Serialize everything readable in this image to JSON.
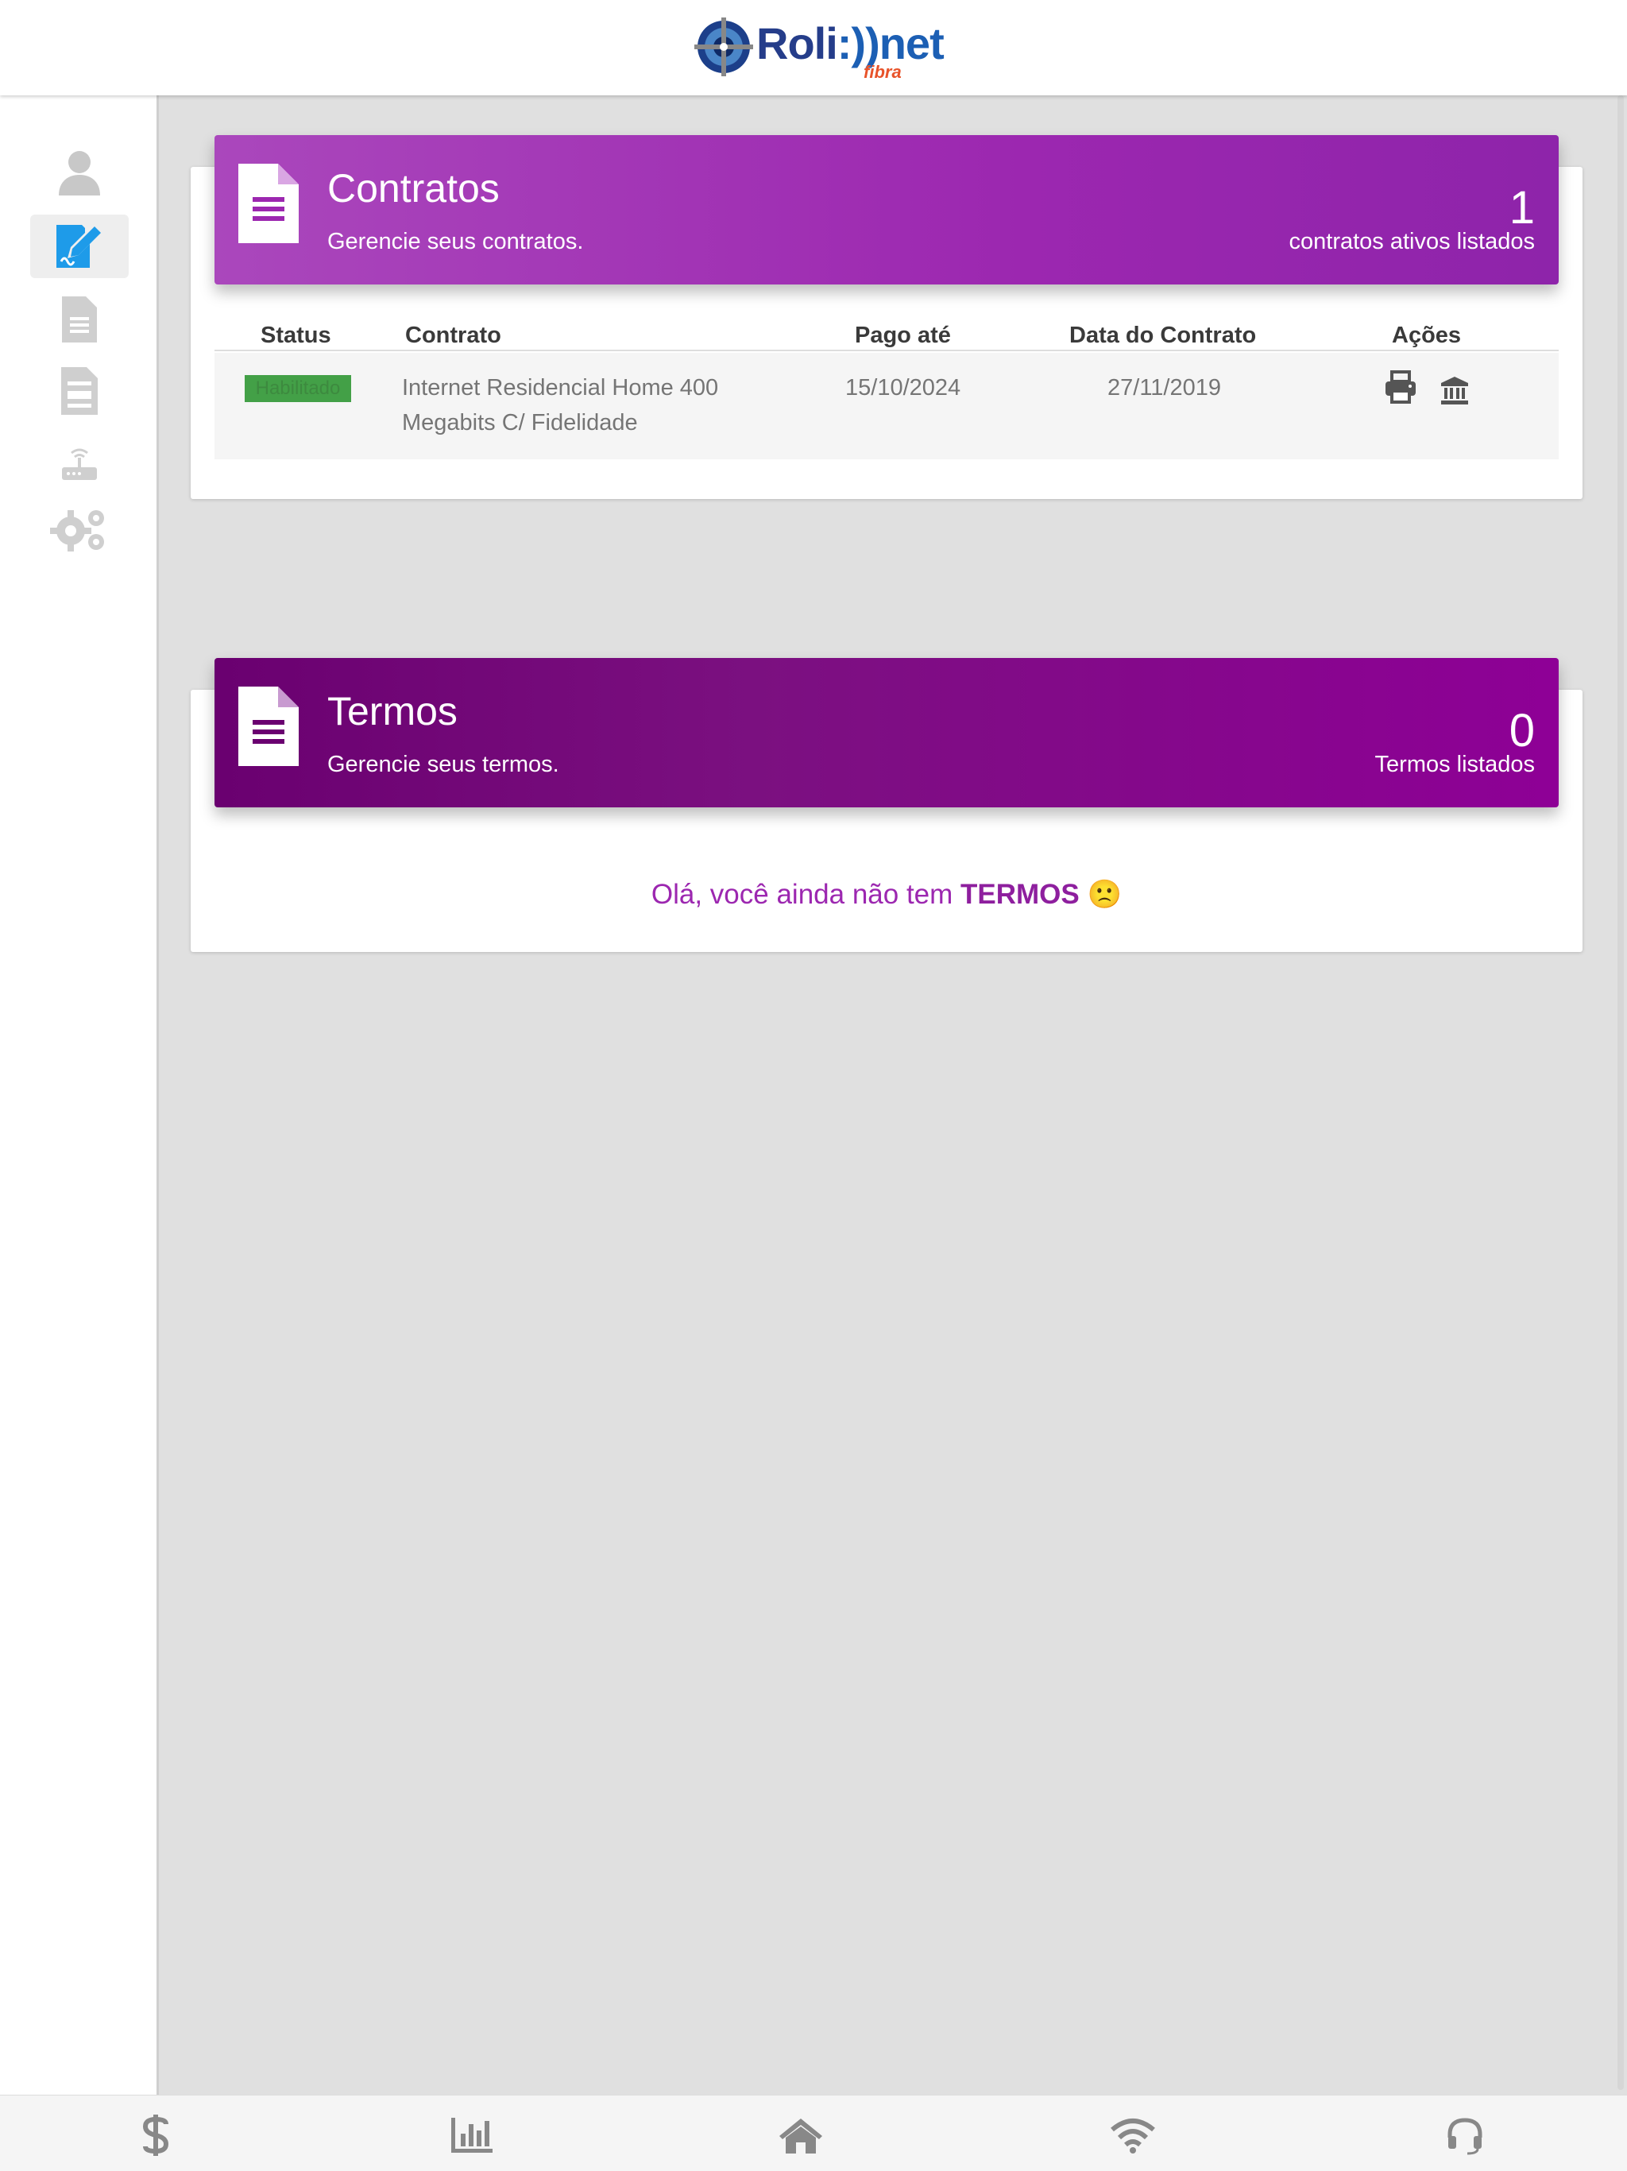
{
  "header": {
    "logo_text_part1": "Roli",
    "logo_text_part2": "net",
    "logo_subtext": "fibra"
  },
  "sidebar": {
    "items": [
      {
        "icon": "user-icon",
        "active": false
      },
      {
        "icon": "contract-sign-icon",
        "active": true
      },
      {
        "icon": "document-icon",
        "active": false
      },
      {
        "icon": "invoice-icon",
        "active": false
      },
      {
        "icon": "router-icon",
        "active": false
      },
      {
        "icon": "gears-icon",
        "active": false
      }
    ]
  },
  "contracts": {
    "title": "Contratos",
    "subtitle": "Gerencie seus contratos.",
    "count": "1",
    "count_label": "contratos ativos listados",
    "table": {
      "headers": [
        "Status",
        "Contrato",
        "Pago até",
        "Data do Contrato",
        "Ações"
      ],
      "rows": [
        {
          "status": "Habilitado",
          "contract_line1": "Internet Residencial Home 400",
          "contract_line2": "Megabits C/ Fidelidade",
          "paid_until": "15/10/2024",
          "contract_date": "27/11/2019"
        }
      ]
    }
  },
  "terms": {
    "title": "Termos",
    "subtitle": "Gerencie seus termos.",
    "count": "0",
    "count_label": "Termos listados",
    "empty_prefix": "Olá, você ainda não tem",
    "empty_strong": "TERMOS",
    "empty_emoji": "🙁"
  },
  "bottom_nav": {
    "items": [
      "dollar-icon",
      "chart-icon",
      "home-icon",
      "wifi-icon",
      "support-headset-icon"
    ]
  },
  "colors": {
    "accent_purple": "#9c27b0",
    "dark_purple": "#7b1080",
    "active_blue": "#1e9be9",
    "status_green": "#43a047"
  }
}
